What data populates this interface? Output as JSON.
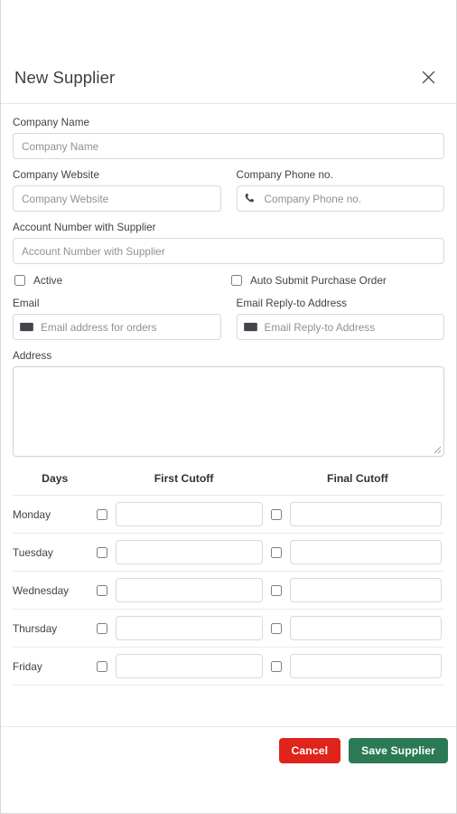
{
  "header": {
    "title": "New Supplier",
    "close_icon": "close-icon"
  },
  "form": {
    "company_name": {
      "label": "Company Name",
      "placeholder": "Company Name",
      "value": ""
    },
    "company_website": {
      "label": "Company Website",
      "placeholder": "Company Website",
      "value": ""
    },
    "company_phone": {
      "label": "Company Phone no.",
      "placeholder": "Company Phone no.",
      "value": "",
      "icon": "phone-icon"
    },
    "account_number": {
      "label": "Account Number with Supplier",
      "placeholder": "Account Number with Supplier",
      "value": ""
    },
    "active": {
      "label": "Active",
      "checked": false
    },
    "auto_submit_purchase_order": {
      "label": "Auto Submit Purchase Order",
      "checked": false
    },
    "email": {
      "label": "Email",
      "placeholder": "Email address for orders",
      "value": "",
      "icon": "envelope-icon"
    },
    "email_reply_to": {
      "label": "Email Reply-to Address",
      "placeholder": "Email Reply-to Address",
      "value": "",
      "icon": "envelope-icon"
    },
    "address": {
      "label": "Address",
      "placeholder": "",
      "value": ""
    }
  },
  "cutoff_table": {
    "columns": [
      "Days",
      "First Cutoff",
      "Final Cutoff"
    ],
    "rows": [
      {
        "day": "Monday",
        "first_checked": false,
        "first_value": "",
        "final_checked": false,
        "final_value": ""
      },
      {
        "day": "Tuesday",
        "first_checked": false,
        "first_value": "",
        "final_checked": false,
        "final_value": ""
      },
      {
        "day": "Wednesday",
        "first_checked": false,
        "first_value": "",
        "final_checked": false,
        "final_value": ""
      },
      {
        "day": "Thursday",
        "first_checked": false,
        "first_value": "",
        "final_checked": false,
        "final_value": ""
      },
      {
        "day": "Friday",
        "first_checked": false,
        "first_value": "",
        "final_checked": false,
        "final_value": ""
      }
    ]
  },
  "footer": {
    "cancel_label": "Cancel",
    "save_label": "Save Supplier",
    "cancel_color": "#e0241b",
    "save_color": "#2b7a55"
  }
}
